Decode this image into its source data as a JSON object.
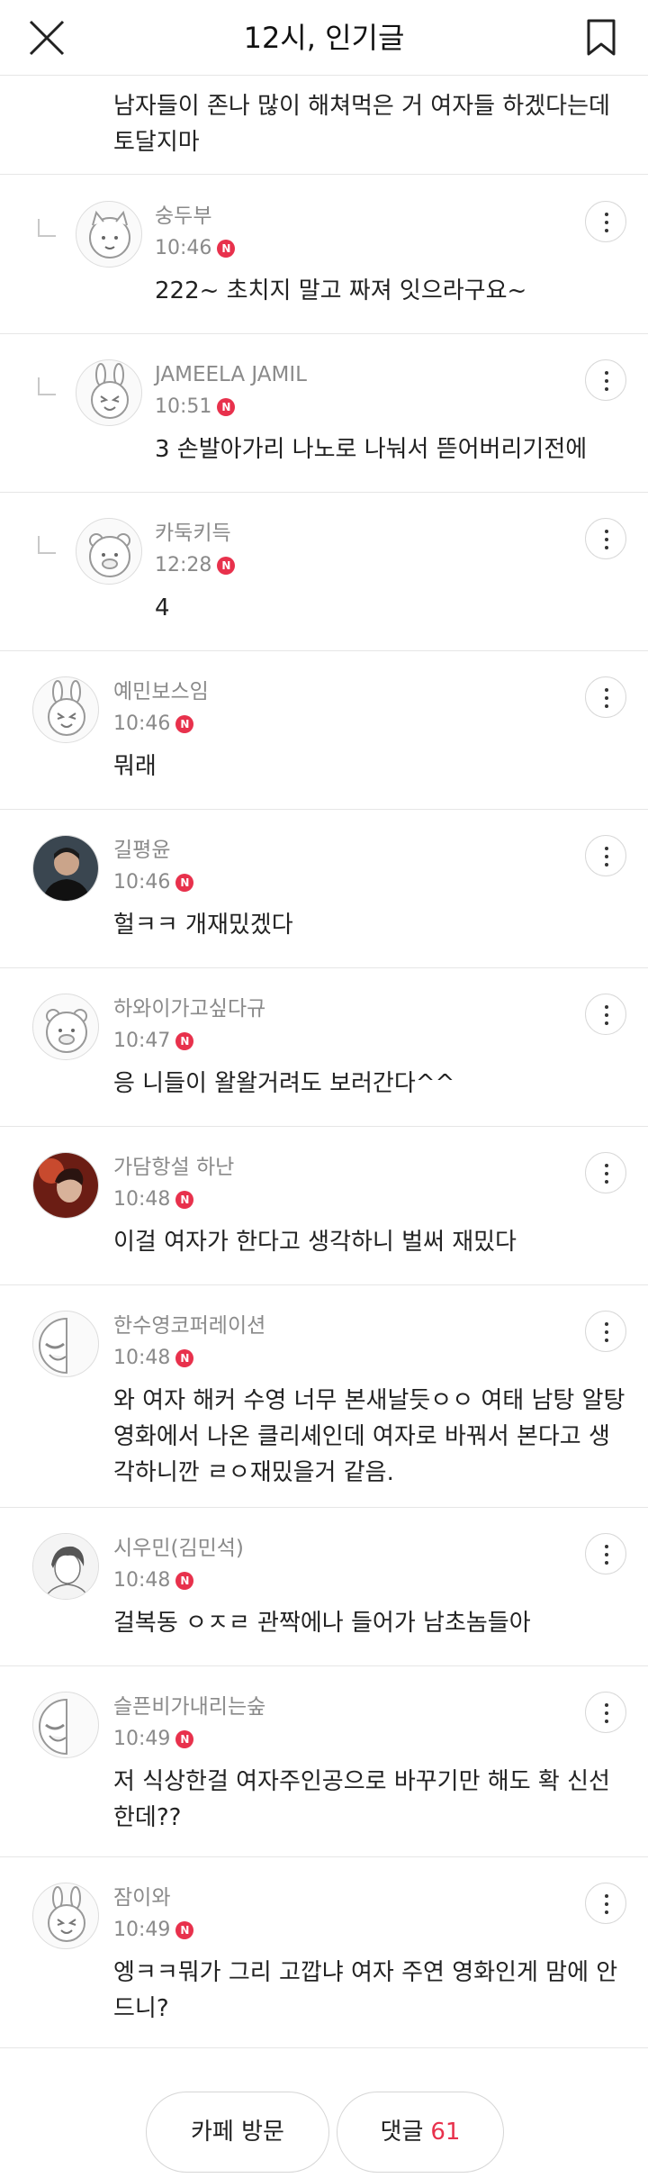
{
  "header": {
    "title": "12시, 인기글"
  },
  "continuation_text": "남자들이 존나 많이 해쳐먹은 거 여자들 하겠다는데 토달지마",
  "comments": [
    {
      "user": "숭두부",
      "time": "10:46",
      "badge": "N",
      "text": "222~ 초치지 말고 짜져 잇으라구요~",
      "reply": true,
      "avatar": "peach-cat"
    },
    {
      "user": "JAMEELA JAMIL",
      "time": "10:51",
      "badge": "N",
      "text": "3 손발아가리 나노로 나눠서 뜯어버리기전에",
      "reply": true,
      "avatar": "rabbit"
    },
    {
      "user": "카둑키득",
      "time": "12:28",
      "badge": "N",
      "text": "4",
      "reply": true,
      "avatar": "bear"
    },
    {
      "user": "예민보스임",
      "time": "10:46",
      "badge": "N",
      "text": "뭐래",
      "reply": false,
      "avatar": "rabbit"
    },
    {
      "user": "길평윤",
      "time": "10:46",
      "badge": "N",
      "text": "헐ㅋㅋ 개재밌겠다",
      "reply": false,
      "avatar": "photo-man"
    },
    {
      "user": "하와이가고싶다규",
      "time": "10:47",
      "badge": "N",
      "text": "응 니들이 왈왈거려도 보러간다^^",
      "reply": false,
      "avatar": "bear"
    },
    {
      "user": "가담항설 하난",
      "time": "10:48",
      "badge": "N",
      "text": "이걸 여자가 한다고 생각하니 벌써 재밌다",
      "reply": false,
      "avatar": "photo-red"
    },
    {
      "user": "한수영코퍼레이션",
      "time": "10:48",
      "badge": "N",
      "text": "와 여자 해커 수영 너무 본새날듯ㅇㅇ 여태 남탕 알탕 영화에서 나온 클리셰인데 여자로 바꿔서 본다고 생각하니깐 ㄹㅇ재밌을거 같음.",
      "reply": false,
      "avatar": "laugh"
    },
    {
      "user": "시우민(김민석)",
      "time": "10:48",
      "badge": "N",
      "text": "걸복동 ㅇㅈㄹ 관짝에나 들어가 남초놈들아",
      "reply": false,
      "avatar": "sketch"
    },
    {
      "user": "슬픈비가내리는숲",
      "time": "10:49",
      "badge": "N",
      "text": "저 식상한걸 여자주인공으로 바꾸기만 해도 확 신선한데??",
      "reply": false,
      "avatar": "laugh"
    },
    {
      "user": "잠이와",
      "time": "10:49",
      "badge": "N",
      "text": "엥ㅋㅋ뭐가 그리 고깝냐 여자 주연 영화인게 맘에 안드니?",
      "reply": false,
      "avatar": "rabbit"
    }
  ],
  "bottom": {
    "visit_label": "카페 방문",
    "comments_label": "댓글",
    "comments_count": "61"
  },
  "colors": {
    "accent": "#e8314c",
    "muted": "#8a8a8a",
    "divider": "#e6e6e6"
  }
}
